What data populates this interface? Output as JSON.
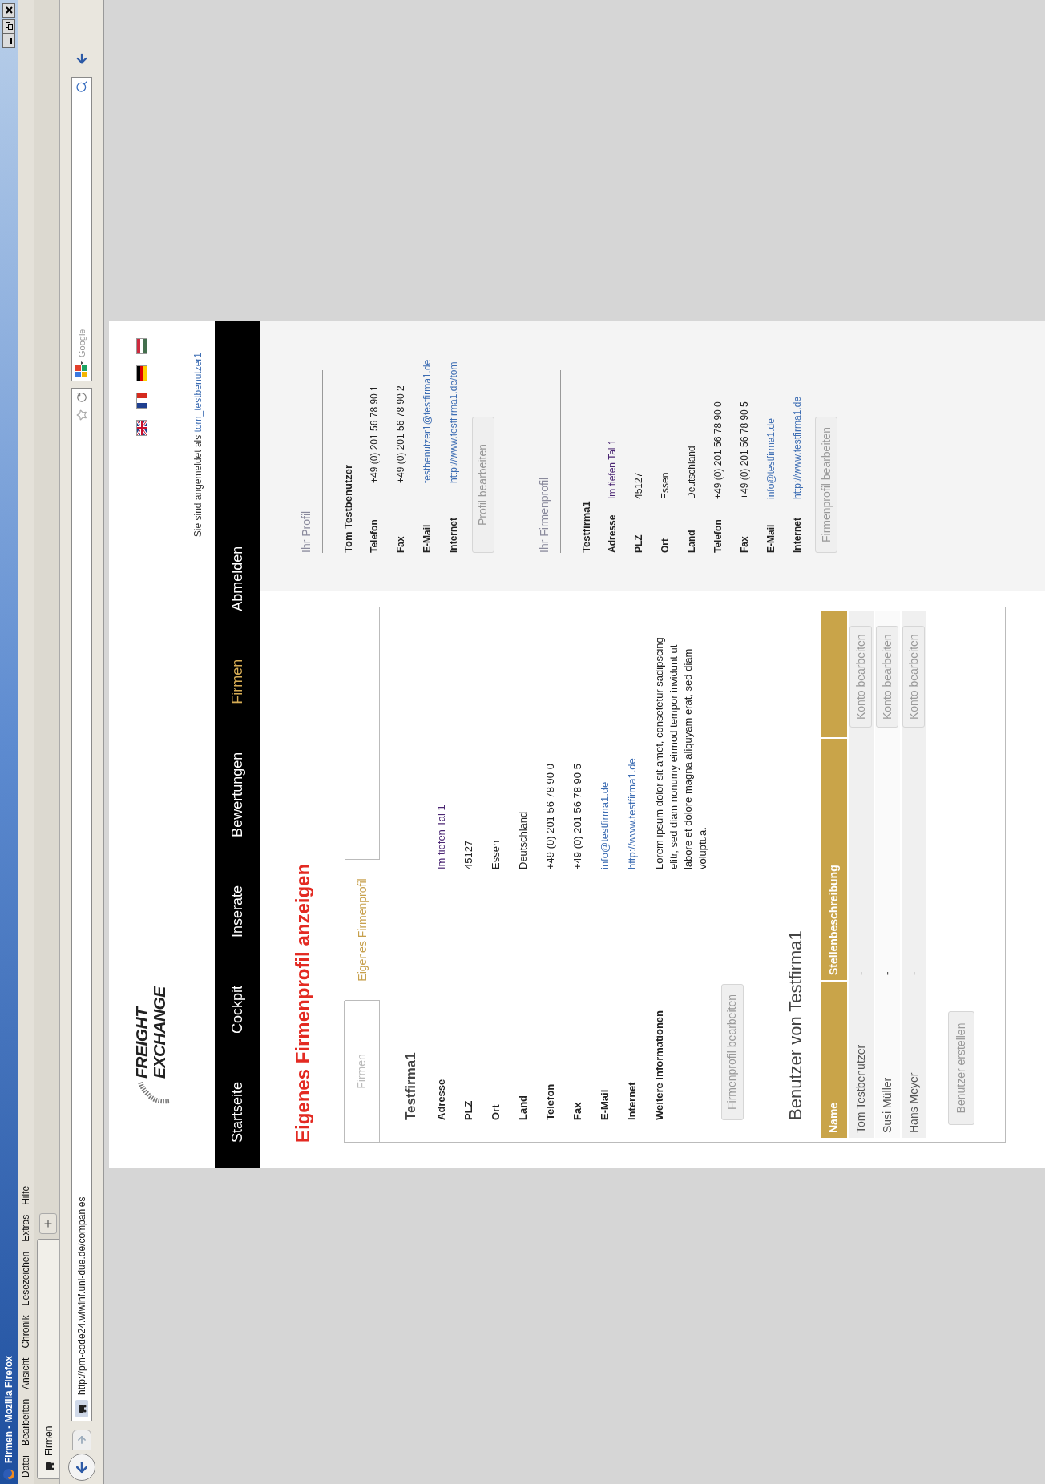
{
  "window": {
    "title": "Firmen - Mozilla Firefox"
  },
  "menu": [
    "Datei",
    "Bearbeiten",
    "Ansicht",
    "Chronik",
    "Lesezeichen",
    "Extras",
    "Hilfe"
  ],
  "tabs": [
    {
      "label": "Firmen",
      "selected": true
    }
  ],
  "address_bar": {
    "url": "http://pm-code24.wiwinf.uni-due.de/companies"
  },
  "search": {
    "placeholder": "Google"
  },
  "site": {
    "logo": [
      "FREIGHT",
      "EXCHANGE"
    ],
    "flags": [
      {
        "kind": "uk"
      },
      {
        "kind": "fr"
      },
      {
        "kind": "de"
      },
      {
        "kind": "hu"
      }
    ],
    "login_text": "Sie sind angemeldet als",
    "login_user": "tom_testbenutzer1",
    "nav": [
      {
        "label": "Startseite",
        "selected": false
      },
      {
        "label": "Cockpit",
        "selected": false
      },
      {
        "label": "Inserate",
        "selected": false
      },
      {
        "label": "Bewertungen",
        "selected": false
      },
      {
        "label": "Firmen",
        "selected": true
      },
      {
        "label": "Abmelden",
        "selected": false
      }
    ]
  },
  "page_title": "Eigenes Firmenprofil anzeigen",
  "content_tabs": [
    {
      "label": "Firmen",
      "selected": false
    },
    {
      "label": "Eigenes Firmenprofil",
      "selected": true
    }
  ],
  "company": {
    "name": "Testfirma1",
    "fields": [
      {
        "label": "Adresse",
        "value": "Im tiefen Tal 1",
        "kind": "visited"
      },
      {
        "label": "PLZ",
        "value": "45127",
        "kind": "text"
      },
      {
        "label": "Ort",
        "value": "Essen",
        "kind": "text"
      },
      {
        "label": "Land",
        "value": "Deutschland",
        "kind": "text"
      },
      {
        "label": "Telefon",
        "value": "+49 (0) 201 56 78 90 0",
        "kind": "text"
      },
      {
        "label": "Fax",
        "value": "+49 (0) 201 56 78 90 5",
        "kind": "text"
      },
      {
        "label": "E-Mail",
        "value": "info@testfirma1.de",
        "kind": "link"
      },
      {
        "label": "Internet",
        "value": "http://www.testfirma1.de",
        "kind": "link"
      },
      {
        "label": "Weitere Informationen",
        "value": "Lorem ipsum dolor sit amet, consetetur sadipscing elitr, sed diam nonumy eirmod tempor invidunt ut labore et dolore magna aliquyam erat, sed diam voluptua.",
        "kind": "text"
      }
    ],
    "button": "Firmenprofil bearbeiten"
  },
  "users": {
    "title": "Benutzer von Testfirma1",
    "columns": [
      "Name",
      "Stellenbeschreibung"
    ],
    "rows": [
      {
        "name": "Tom Testbenutzer",
        "description": "-",
        "action": "Konto bearbeiten"
      },
      {
        "name": "Susi Müller",
        "description": "-",
        "action": "Konto bearbeiten"
      },
      {
        "name": "Hans Meyer",
        "description": "-",
        "action": "Konto bearbeiten"
      }
    ],
    "button": "Benutzer erstellen"
  },
  "sidebar": [
    {
      "title": "Ihr Profil",
      "name": "Tom Testbenutzer",
      "fields": [
        {
          "label": "Telefon",
          "value": "+49 (0) 201 56 78 90 1",
          "kind": "text"
        },
        {
          "label": "Fax",
          "value": "+49 (0) 201 56 78 90 2",
          "kind": "text"
        },
        {
          "label": "E-Mail",
          "value": "testbenutzer1@testfirma1.de",
          "kind": "link"
        },
        {
          "label": "Internet",
          "value": "http://www.testfirma1.de/tom",
          "kind": "link"
        }
      ],
      "button": "Profil bearbeiten"
    },
    {
      "title": "Ihr Firmenprofil",
      "name": "Testfirma1",
      "fields": [
        {
          "label": "Adresse",
          "value": "Im tiefen Tal 1",
          "kind": "visited"
        },
        {
          "label": "PLZ",
          "value": "45127",
          "kind": "text"
        },
        {
          "label": "Ort",
          "value": "Essen",
          "kind": "text"
        },
        {
          "label": "Land",
          "value": "Deutschland",
          "kind": "text"
        },
        {
          "label": "Telefon",
          "value": "+49 (0) 201 56 78 90 0",
          "kind": "text"
        },
        {
          "label": "Fax",
          "value": "+49 (0) 201 56 78 90 5",
          "kind": "text"
        },
        {
          "label": "E-Mail",
          "value": "info@testfirma1.de",
          "kind": "link"
        },
        {
          "label": "Internet",
          "value": "http://www.testfirma1.de",
          "kind": "link"
        }
      ],
      "button": "Firmenprofil bearbeiten"
    }
  ]
}
